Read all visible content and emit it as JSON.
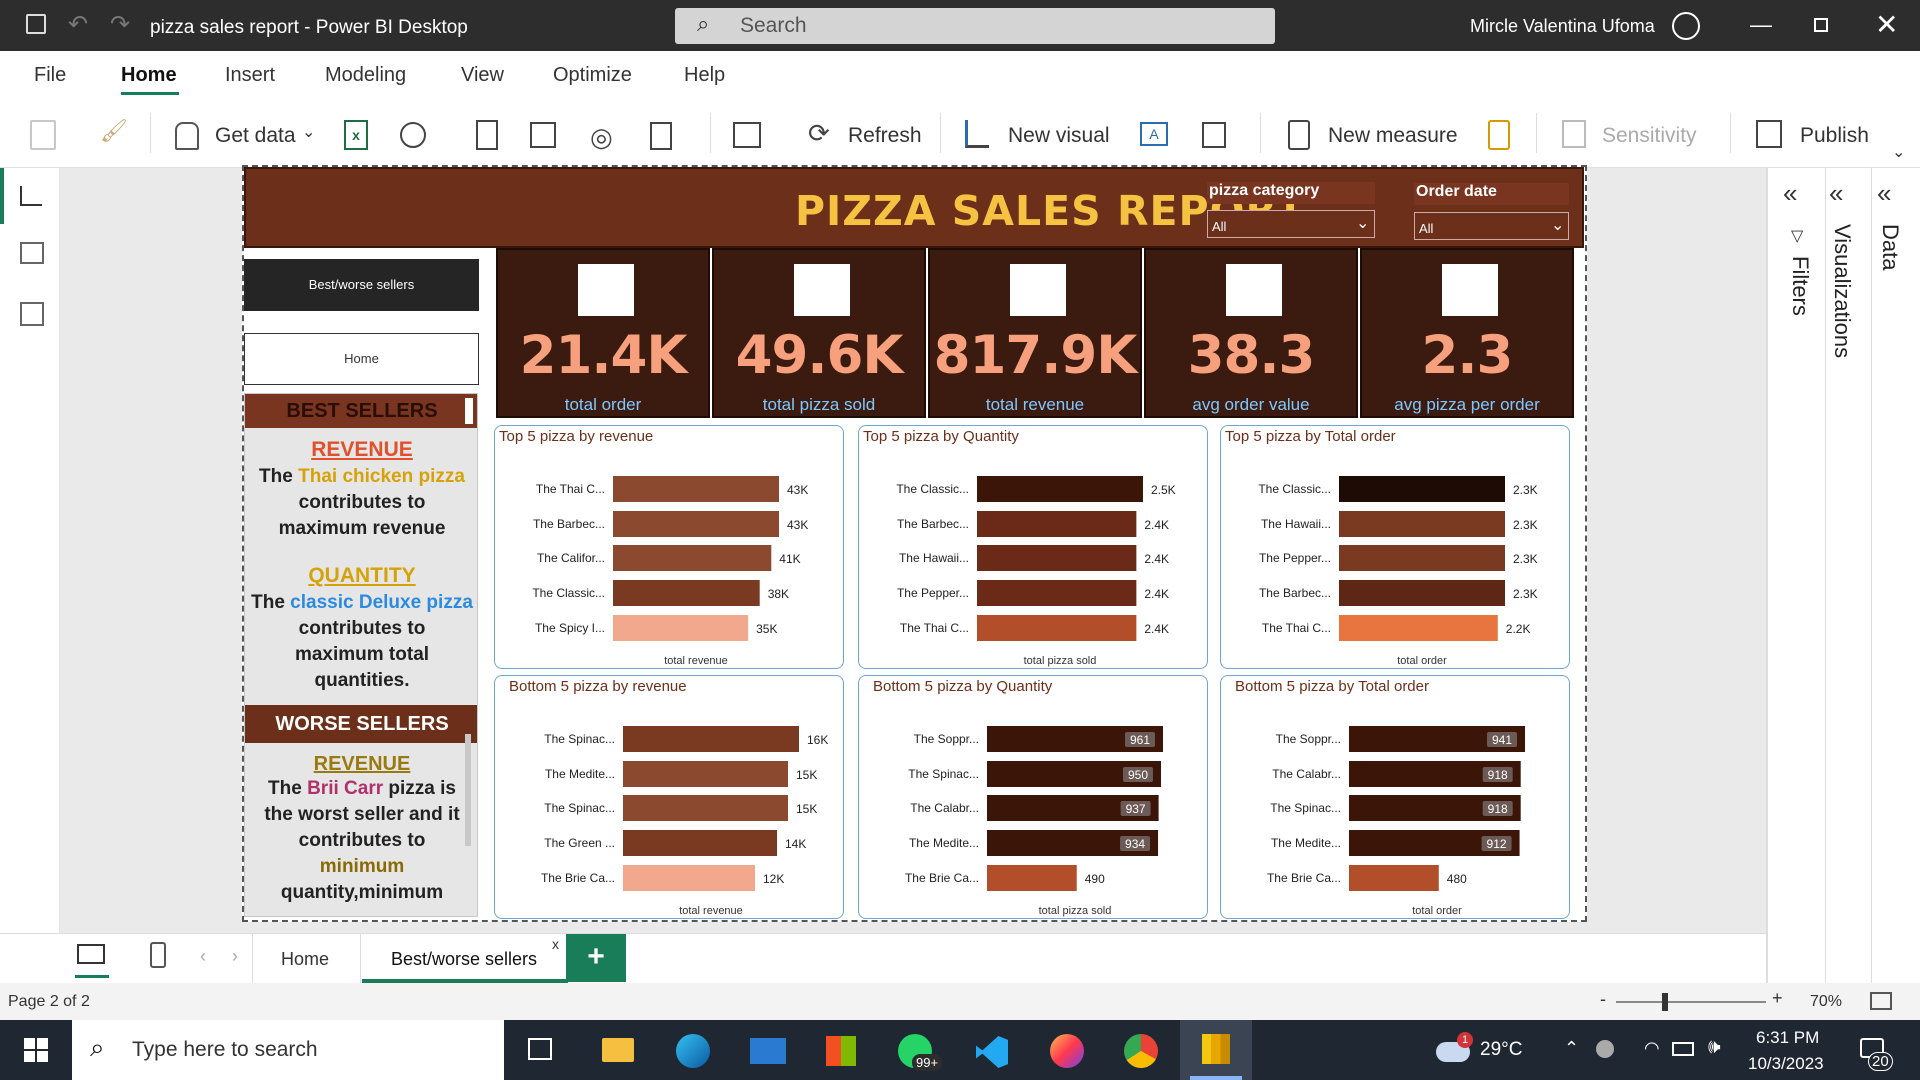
{
  "window": {
    "title": "pizza sales report - Power BI Desktop",
    "search_placeholder": "Search",
    "user": "Mircle Valentina Ufoma"
  },
  "menu": [
    "File",
    "Home",
    "Insert",
    "Modeling",
    "View",
    "Optimize",
    "Help"
  ],
  "ribbon": {
    "get_data": "Get data",
    "refresh": "Refresh",
    "new_visual": "New visual",
    "new_measure": "New measure",
    "sensitivity": "Sensitivity",
    "publish": "Publish"
  },
  "report": {
    "title": "PIZZA SALES REPORT",
    "slicers": [
      {
        "label": "pizza category",
        "value": "All"
      },
      {
        "label": "Order date",
        "value": "All"
      }
    ],
    "nav": {
      "best_worse": "Best/worse sellers",
      "home": "Home"
    },
    "kpis": [
      {
        "value": "21.4K",
        "label": "total order",
        "icon": "delivery-person-icon"
      },
      {
        "value": "49.6K",
        "label": "total pizza sold",
        "icon": "pizza-slice-icon"
      },
      {
        "value": "817.9K",
        "label": "total revenue",
        "icon": "money-globe-icon"
      },
      {
        "value": "38.3",
        "label": "avg order value",
        "icon": "shopping-cart-icon"
      },
      {
        "value": "2.3",
        "label": "avg pizza per order",
        "icon": "growth-chart-icon"
      }
    ],
    "insights": {
      "best_header": "BEST SELLERS",
      "best_rev_head": "REVENUE",
      "best_rev_pre": "The ",
      "best_rev_hl": "Thai chicken pizza",
      "best_rev_post": "contributes to maximum revenue",
      "best_qty_head": "QUANTITY",
      "best_qty_pre": "The ",
      "best_qty_hl": "classic Deluxe pizza",
      "best_qty_post": "contributes to maximum total quantities.",
      "worse_header": "WORSE SELLERS",
      "worse_rev_head": "REVENUE",
      "worse_pre": "The ",
      "worse_hl": "Brii Carr",
      "worse_post": " pizza is the worst seller and it contributes to ",
      "worse_min": "minimum",
      "worse_tail": "quantity,minimum"
    }
  },
  "chart_data": [
    {
      "type": "bar",
      "title": "Top 5 pizza by revenue",
      "xlabel": "total revenue",
      "categories": [
        "The Thai C...",
        "The Barbec...",
        "The Califor...",
        "The Classic...",
        "The Spicy I..."
      ],
      "values": [
        43,
        43,
        41,
        38,
        35
      ],
      "labels": [
        "43K",
        "43K",
        "41K",
        "38K",
        "35K"
      ],
      "colors": [
        "#8b4a2f",
        "#8b4a2f",
        "#8b4a2f",
        "#7a3a22",
        "#f2a88c"
      ]
    },
    {
      "type": "bar",
      "title": "Top 5 pizza by Quantity",
      "xlabel": "total pizza sold",
      "categories": [
        "The Classic...",
        "The Barbec...",
        "The Hawaii...",
        "The Pepper...",
        "The Thai C..."
      ],
      "values": [
        2.5,
        2.4,
        2.4,
        2.4,
        2.4
      ],
      "labels": [
        "2.5K",
        "2.4K",
        "2.4K",
        "2.4K",
        "2.4K"
      ],
      "colors": [
        "#3b1508",
        "#6b2a17",
        "#6b2a17",
        "#6b2a17",
        "#b24f2a"
      ]
    },
    {
      "type": "bar",
      "title": "Top 5 pizza by Total order",
      "xlabel": "total order",
      "categories": [
        "The Classic...",
        "The Hawaii...",
        "The Pepper...",
        "The Barbec...",
        "The Thai C..."
      ],
      "values": [
        2.3,
        2.3,
        2.3,
        2.3,
        2.2
      ],
      "labels": [
        "2.3K",
        "2.3K",
        "2.3K",
        "2.3K",
        "2.2K"
      ],
      "colors": [
        "#1e0b05",
        "#7a3a22",
        "#7a3a22",
        "#5e2614",
        "#e8743f"
      ]
    },
    {
      "type": "bar",
      "title": "Bottom 5 pizza by revenue",
      "xlabel": "total revenue",
      "categories": [
        "The Spinac...",
        "The Medite...",
        "The Spinac...",
        "The Green ...",
        "The Brie Ca..."
      ],
      "values": [
        16,
        15,
        15,
        14,
        12
      ],
      "labels": [
        "16K",
        "15K",
        "15K",
        "14K",
        "12K"
      ],
      "colors": [
        "#7a3a22",
        "#8b4a2f",
        "#8b4a2f",
        "#7a3a22",
        "#f2a88c"
      ]
    },
    {
      "type": "bar",
      "title": "Bottom 5 pizza by Quantity",
      "xlabel": "total pizza sold",
      "categories": [
        "The Soppr...",
        "The Spinac...",
        "The Calabr...",
        "The Medite...",
        "The Brie Ca..."
      ],
      "values": [
        961,
        950,
        937,
        934,
        490
      ],
      "labels": [
        "961",
        "950",
        "937",
        "934",
        "490"
      ],
      "colors": [
        "#3b1508",
        "#3b1508",
        "#3b1508",
        "#3b1508",
        "#b24f2a"
      ]
    },
    {
      "type": "bar",
      "title": "Bottom 5 pizza by Total order",
      "xlabel": "total order",
      "categories": [
        "The Soppr...",
        "The Calabr...",
        "The Spinac...",
        "The Medite...",
        "The Brie Ca..."
      ],
      "values": [
        941,
        918,
        918,
        912,
        480
      ],
      "labels": [
        "941",
        "918",
        "918",
        "912",
        "480"
      ],
      "colors": [
        "#3b1508",
        "#3b1508",
        "#3b1508",
        "#3b1508",
        "#b24f2a"
      ]
    }
  ],
  "tabs": {
    "home": "Home",
    "active": "Best/worse sellers",
    "close": "x",
    "add": "+"
  },
  "status": {
    "page": "Page 2 of 2",
    "zoom": "70%"
  },
  "rightpane": {
    "filters": "Filters",
    "visualizations": "Visualizations",
    "data": "Data"
  },
  "taskbar": {
    "search": "Type here to search",
    "badge": "99+",
    "temp": "29°C",
    "time": "6:31 PM",
    "date": "10/3/2023",
    "notif": "20",
    "weather_badge": "1"
  }
}
